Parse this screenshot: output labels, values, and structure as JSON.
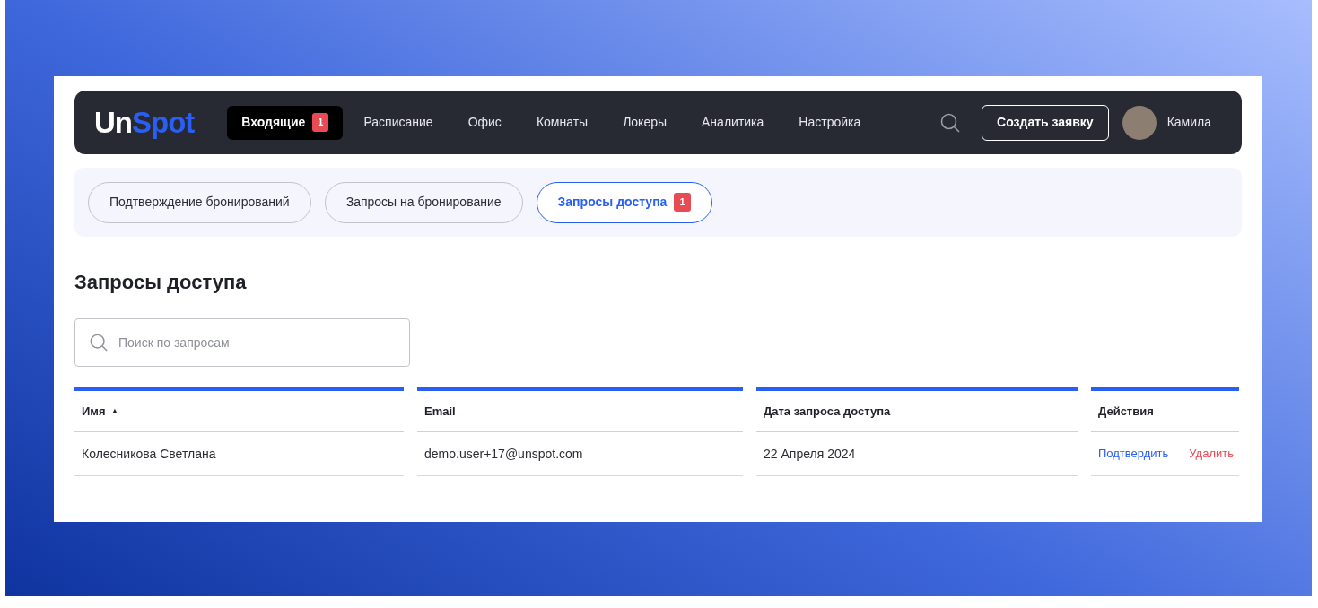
{
  "logo": {
    "first": "Un",
    "second": "Spot"
  },
  "nav": [
    {
      "label": "Входящие",
      "badge": "1",
      "selected": true
    },
    {
      "label": "Расписание",
      "selected": false
    },
    {
      "label": "Офис",
      "selected": false
    },
    {
      "label": "Комнаты",
      "selected": false
    },
    {
      "label": "Локеры",
      "selected": false
    },
    {
      "label": "Аналитика",
      "selected": false
    },
    {
      "label": "Настройка",
      "selected": false
    }
  ],
  "create_button": "Создать заявку",
  "user": {
    "name": "Камила"
  },
  "subtabs": [
    {
      "label": "Подтверждение бронирований",
      "selected": false
    },
    {
      "label": "Запросы на бронирование",
      "selected": false
    },
    {
      "label": "Запросы доступа",
      "badge": "1",
      "selected": true
    }
  ],
  "heading": "Запросы доступа",
  "search": {
    "placeholder": "Поиск по запросам"
  },
  "table": {
    "columns": [
      {
        "label": "Имя",
        "sort": "▲"
      },
      {
        "label": "Email"
      },
      {
        "label": "Дата запроса доступа"
      },
      {
        "label": "Действия"
      }
    ],
    "rows": [
      {
        "name": "Колесникова Светлана",
        "email": "demo.user+17@unspot.com",
        "date": "22 Апреля 2024",
        "actions": [
          {
            "label": "Подтвердить",
            "kind": "confirm"
          },
          {
            "label": "Удалить",
            "kind": "delete"
          }
        ]
      }
    ]
  }
}
